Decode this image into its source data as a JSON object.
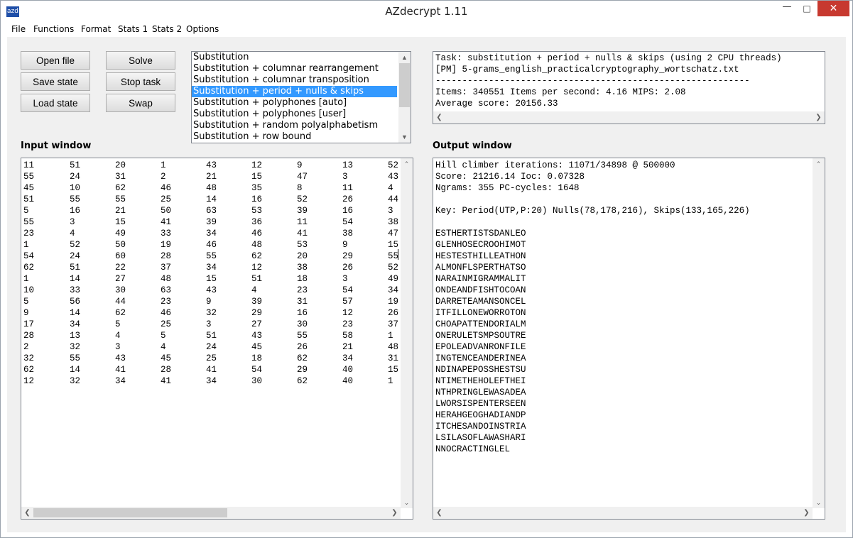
{
  "window": {
    "title": "AZdecrypt 1.11",
    "icon_label": "azd",
    "minimize_glyph": "—",
    "maximize_glyph": "□",
    "close_glyph": "✕"
  },
  "menu": [
    "File",
    "Functions",
    "Format",
    "Stats 1",
    "Stats 2",
    "Options"
  ],
  "buttons": {
    "open_file": "Open file",
    "save_state": "Save state",
    "load_state": "Load state",
    "solve": "Solve",
    "stop_task": "Stop task",
    "swap": "Swap"
  },
  "solvers": {
    "items": [
      "Substitution",
      "Substitution + columnar rearrangement",
      "Substitution + columnar transposition",
      "Substitution + period + nulls & skips",
      "Substitution + polyphones [auto]",
      "Substitution + polyphones [user]",
      "Substitution + random polyalphabetism",
      "Substitution + row bound"
    ],
    "selected_index": 3
  },
  "status": {
    "lines": [
      "Task: substitution + period + nulls & skips (using 2 CPU threads)",
      "[PM] 5-grams_english_practicalcryptography_wortschatz.txt",
      "-----------------------------------------------------------",
      "Items: 340551 Items per second: 4.16 MIPS: 2.08",
      "Average score: 20156.33"
    ]
  },
  "input": {
    "label": "Input window",
    "rows": [
      [
        "11",
        "51",
        "20",
        "1",
        "43",
        "12",
        "9",
        "13",
        "52"
      ],
      [
        "55",
        "24",
        "31",
        "2",
        "21",
        "15",
        "47",
        "3",
        "43"
      ],
      [
        "45",
        "10",
        "62",
        "46",
        "48",
        "35",
        "8",
        "11",
        "4"
      ],
      [
        "51",
        "55",
        "55",
        "25",
        "14",
        "16",
        "52",
        "26",
        "44"
      ],
      [
        "5",
        "16",
        "21",
        "50",
        "63",
        "53",
        "39",
        "16",
        "3"
      ],
      [
        "55",
        "3",
        "15",
        "41",
        "39",
        "36",
        "11",
        "54",
        "38"
      ],
      [
        "23",
        "4",
        "49",
        "33",
        "34",
        "46",
        "41",
        "38",
        "47"
      ],
      [
        "1",
        "52",
        "50",
        "19",
        "46",
        "48",
        "53",
        "9",
        "15"
      ],
      [
        "54",
        "24",
        "60",
        "28",
        "55",
        "62",
        "20",
        "29",
        "55"
      ],
      [
        "62",
        "51",
        "22",
        "37",
        "34",
        "12",
        "38",
        "26",
        "52"
      ],
      [
        "1",
        "14",
        "27",
        "48",
        "15",
        "51",
        "18",
        "3",
        "49"
      ],
      [
        "10",
        "33",
        "30",
        "63",
        "43",
        "4",
        "23",
        "54",
        "34"
      ],
      [
        "5",
        "56",
        "44",
        "23",
        "9",
        "39",
        "31",
        "57",
        "19"
      ],
      [
        "9",
        "14",
        "62",
        "46",
        "32",
        "29",
        "16",
        "12",
        "26"
      ],
      [
        "17",
        "34",
        "5",
        "25",
        "3",
        "27",
        "30",
        "23",
        "37"
      ],
      [
        "28",
        "13",
        "4",
        "5",
        "51",
        "43",
        "55",
        "58",
        "1"
      ],
      [
        "2",
        "32",
        "3",
        "4",
        "24",
        "45",
        "26",
        "21",
        "48"
      ],
      [
        "32",
        "55",
        "43",
        "45",
        "25",
        "18",
        "62",
        "34",
        "31"
      ],
      [
        "62",
        "14",
        "41",
        "28",
        "41",
        "54",
        "29",
        "40",
        "15"
      ],
      [
        "12",
        "32",
        "34",
        "41",
        "34",
        "30",
        "62",
        "40",
        "1"
      ]
    ]
  },
  "output": {
    "label": "Output window",
    "lines": [
      "Hill climber iterations: 11071/34898 @ 500000",
      "Score: 21216.14 Ioc: 0.07328",
      "Ngrams: 355 PC-cycles: 1648",
      "",
      "Key: Period(UTP,P:20) Nulls(78,178,216), Skips(133,165,226)",
      "",
      "ESTHERTISTSDANLEO",
      "GLENHOSECROOHIMOT",
      "HESTESTHILLEATHON",
      "ALMONFLSPERTHATSO",
      "NARAINMIGRAMMALIT",
      "ONDEANDFISHTOCOAN",
      "DARRETEAMANSONCEL",
      "ITFILLONEWORROTON",
      "CHOAPATTENDORIALM",
      "ONERULETSMPSOUTRE",
      "EPOLEADVANRONFILE",
      "INGTENCEANDERINEA",
      "NDINAPEPOSSHESTSU",
      "NTIMETHEHOLEFTHEI",
      "NTHPRINGLEWASADEA",
      "LWORSISPENTERSEEN",
      "HERAHGEOGHADIANDP",
      "ITCHESANDOINSTRIA",
      "LSILASOFLAWASHARI",
      "NNOCRACTINGLEL"
    ]
  }
}
